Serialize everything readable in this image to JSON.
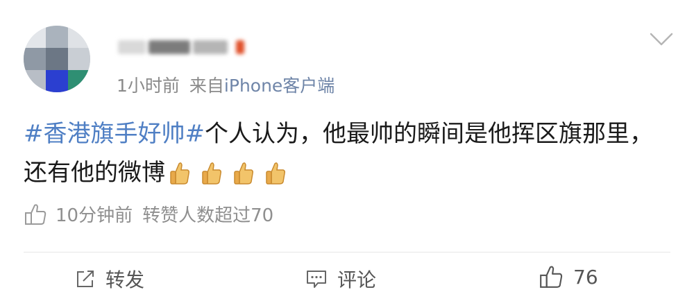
{
  "post": {
    "time": "1小时前",
    "source_prefix": "来自",
    "source": "iPhone客户端",
    "hashtag": "#香港旗手好帅#",
    "text": "个人认为，他最帅的瞬间是他挥区旗那里，还有他的微博",
    "emoji": "thumbs-up-emoji",
    "emoji_count": 4
  },
  "stats": {
    "time": "10分钟前",
    "note": "转赞人数超过70"
  },
  "actions": {
    "repost_label": "转发",
    "comment_label": "评论",
    "like_count": "76"
  },
  "colors": {
    "link": "#4f7fc4",
    "meta_text": "#8a8a8a",
    "source": "#6f85a8"
  }
}
